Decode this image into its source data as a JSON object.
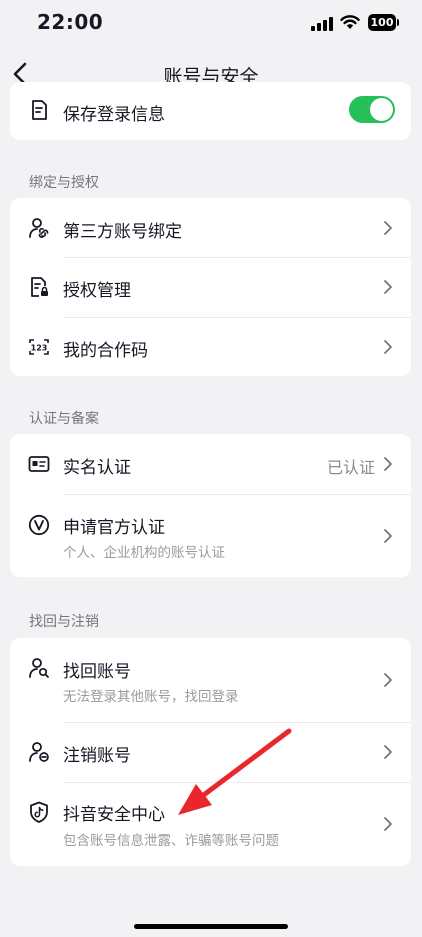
{
  "status_bar": {
    "time": "22:00",
    "battery": "100"
  },
  "header": {
    "title": "账号与安全"
  },
  "save_login": {
    "label": "保存登录信息",
    "toggle_on": true
  },
  "sections": {
    "binding": {
      "label": "绑定与授权",
      "items": [
        {
          "label": "第三方账号绑定",
          "icon": "link-user-icon"
        },
        {
          "label": "授权管理",
          "icon": "document-lock-icon"
        },
        {
          "label": "我的合作码",
          "icon": "code-123-icon"
        }
      ]
    },
    "verification": {
      "label": "认证与备案",
      "items": [
        {
          "label": "实名认证",
          "value": "已认证",
          "icon": "id-card-icon"
        },
        {
          "label": "申请官方认证",
          "sub": "个人、企业机构的账号认证",
          "icon": "v-badge-icon"
        }
      ]
    },
    "recovery": {
      "label": "找回与注销",
      "items": [
        {
          "label": "找回账号",
          "sub": "无法登录其他账号，找回登录",
          "icon": "user-search-icon"
        },
        {
          "label": "注销账号",
          "icon": "user-remove-icon"
        },
        {
          "label": "抖音安全中心",
          "sub": "包含账号信息泄露、诈骗等账号问题",
          "icon": "shield-tiktok-icon"
        }
      ]
    }
  },
  "colors": {
    "toggle": "#25c05a",
    "arrow": "#e8262b",
    "background": "#f2f2f5"
  }
}
